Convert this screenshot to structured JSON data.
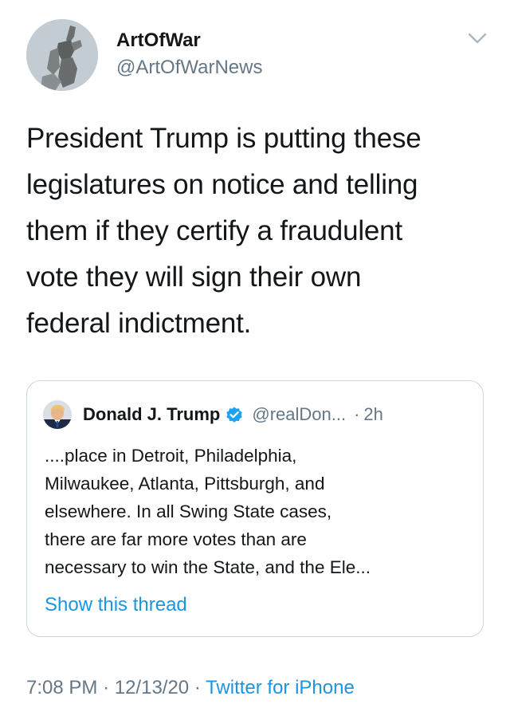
{
  "author": {
    "display_name": "ArtOfWar",
    "handle": "@ArtOfWarNews",
    "avatar_icon": "profile-photo-statue"
  },
  "tweet": {
    "text": "President Trump is putting these\nlegislatures on notice and telling\nthem if they certify a fraudulent\nvote they will sign their own\nfederal indictment."
  },
  "quoted": {
    "display_name": "Donald J. Trump",
    "handle": "@realDon...",
    "separator": "·",
    "time": "2h",
    "verified_icon": "verified-badge-icon",
    "text": "....place in Detroit, Philadelphia,\nMilwaukee, Atlanta, Pittsburgh, and\nelsewhere. In all Swing State cases,\nthere are far more votes than are\nnecessary to win the State, and the Ele...",
    "show_thread": "Show this thread"
  },
  "footer": {
    "time": "7:08 PM",
    "sep1": "·",
    "date": "12/13/20",
    "sep2": "·",
    "source": "Twitter for iPhone"
  },
  "colors": {
    "text_primary": "#14171a",
    "text_secondary": "#657786",
    "link": "#1b95e0",
    "verified": "#1da1f2",
    "border": "#ccd6dd"
  }
}
